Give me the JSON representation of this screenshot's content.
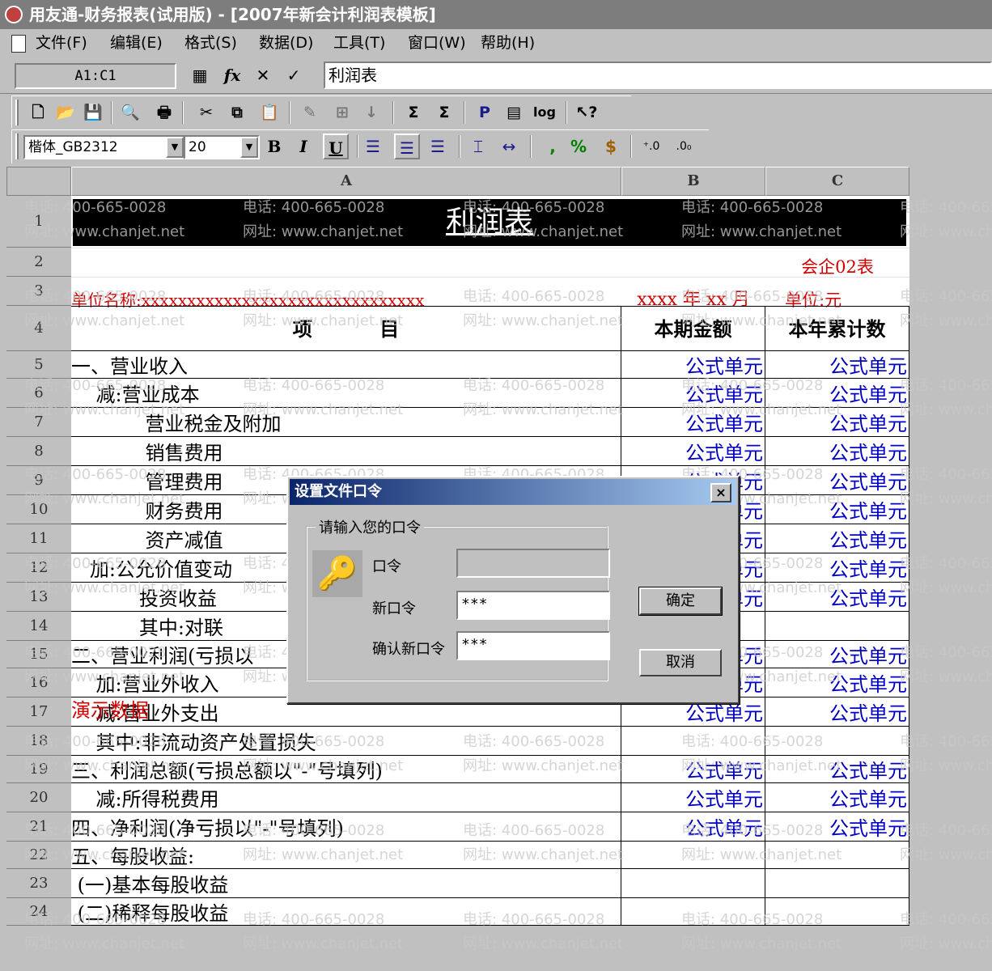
{
  "window": {
    "title": "用友通-财务报表(试用版) - [2007年新会计利润表模板]"
  },
  "menu": [
    "文件(F)",
    "编辑(E)",
    "格式(S)",
    "数据(D)",
    "工具(T)",
    "窗口(W)",
    "帮助(H)"
  ],
  "formula_bar": {
    "cell_ref": "A1:C1",
    "fx": "fx",
    "content": "利润表"
  },
  "format_toolbar": {
    "font_name": "楷体_GB2312",
    "font_size": "20"
  },
  "columns": [
    "A",
    "B",
    "C"
  ],
  "report": {
    "title": "利润表",
    "form_code": "会企02表",
    "unit_name_label": "单位名称:",
    "unit_name_value": "xxxxxxxxxxxxxxxxxxxxxxxxxxxxxxx",
    "period": "xxxx 年 xx 月",
    "unit": "单位:元",
    "col_item": "项          目",
    "col_current": "本期金额",
    "col_ytd": "本年累计数",
    "demo_label": "演示数据"
  },
  "rows": [
    {
      "num": "1",
      "label": "",
      "b": "",
      "c": ""
    },
    {
      "num": "2",
      "label": "",
      "b": "",
      "c": ""
    },
    {
      "num": "3",
      "label": "",
      "b": "",
      "c": ""
    },
    {
      "num": "4",
      "label": "",
      "b": "",
      "c": ""
    },
    {
      "num": "5",
      "label": "一、营业收入",
      "b": "公式单元",
      "c": "公式单元"
    },
    {
      "num": "6",
      "label": "    减:营业成本",
      "b": "公式单元",
      "c": "公式单元"
    },
    {
      "num": "7",
      "label": "            营业税金及附加",
      "b": "公式单元",
      "c": "公式单元"
    },
    {
      "num": "8",
      "label": "            销售费用",
      "b": "公式单元",
      "c": "公式单元"
    },
    {
      "num": "9",
      "label": "            管理费用",
      "b": "公式单元",
      "c": "公式单元"
    },
    {
      "num": "10",
      "label": "            财务费用",
      "b": "公式单元",
      "c": "公式单元"
    },
    {
      "num": "11",
      "label": "            资产减值",
      "b": "公式单元",
      "c": "公式单元"
    },
    {
      "num": "12",
      "label": "   加:公允价值变动",
      "b": "公式单元",
      "c": "公式单元"
    },
    {
      "num": "13",
      "label": "           投资收益",
      "b": "公式单元",
      "c": "公式单元"
    },
    {
      "num": "14",
      "label": "           其中:对联",
      "b": "",
      "c": ""
    },
    {
      "num": "15",
      "label": "二、营业利润(亏损以",
      "b": "公式单元",
      "c": "公式单元"
    },
    {
      "num": "16",
      "label": "    加:营业外收入",
      "b": "公式单元",
      "c": "公式单元"
    },
    {
      "num": "17",
      "label": "    减:营业外支出",
      "b": "公式单元",
      "c": "公式单元"
    },
    {
      "num": "18",
      "label": "    其中:非流动资产处置损失",
      "b": "",
      "c": ""
    },
    {
      "num": "19",
      "label": "三、利润总额(亏损总额以\"-\"号填列)",
      "b": "公式单元",
      "c": "公式单元"
    },
    {
      "num": "20",
      "label": "    减:所得税费用",
      "b": "公式单元",
      "c": "公式单元"
    },
    {
      "num": "21",
      "label": "四、净利润(净亏损以\"-\"号填列)",
      "b": "公式单元",
      "c": "公式单元"
    },
    {
      "num": "22",
      "label": "五、每股收益:",
      "b": "",
      "c": ""
    },
    {
      "num": "23",
      "label": " (一)基本每股收益",
      "b": "",
      "c": ""
    },
    {
      "num": "24",
      "label": " (二)稀释每股收益",
      "b": "",
      "c": ""
    }
  ],
  "watermark": {
    "phone": "电话: 400-665-0028",
    "site": "网址: www.chanjet.net"
  },
  "dialog": {
    "title": "设置文件口令",
    "close": "×",
    "group_label": "请输入您的口令",
    "password_label": "口令",
    "password_value": "",
    "new_password_label": "新口令",
    "new_password_value": "***",
    "confirm_label": "确认新口令",
    "confirm_value": "***",
    "ok": "确定",
    "cancel": "取消"
  }
}
